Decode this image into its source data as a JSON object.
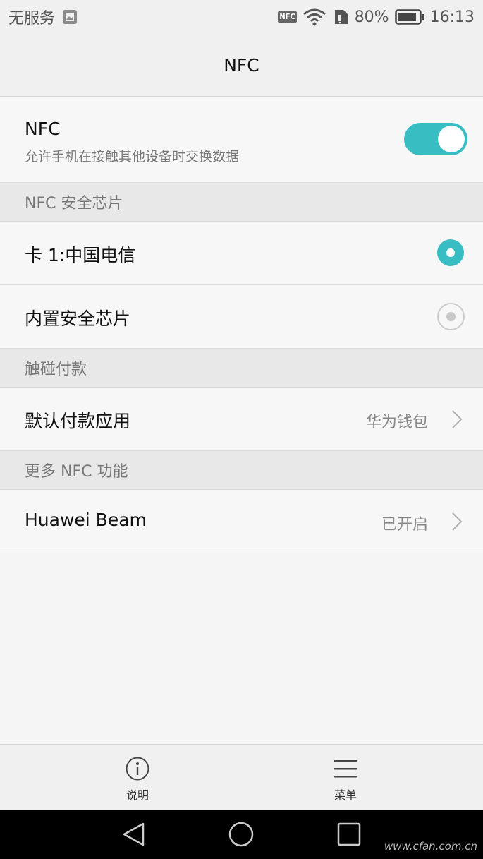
{
  "status_bar": {
    "carrier": "无服务",
    "nfc_badge": "NFC",
    "battery": "80%",
    "time": "16:13"
  },
  "title": "NFC",
  "nfc_row": {
    "title": "NFC",
    "subtitle": "允许手机在接触其他设备时交换数据",
    "toggle_state": "on"
  },
  "sections": {
    "secure_chip": "NFC 安全芯片",
    "tap_pay": "触碰付款",
    "more_nfc": "更多 NFC 功能"
  },
  "secure_chip_options": [
    {
      "label": "卡 1:中国电信",
      "selected": true
    },
    {
      "label": "内置安全芯片",
      "selected": false
    }
  ],
  "default_pay": {
    "label": "默认付款应用",
    "value": "华为钱包"
  },
  "huawei_beam": {
    "label": "Huawei Beam",
    "value": "已开启"
  },
  "bottom_bar": {
    "help_label": "说明",
    "menu_label": "菜单"
  },
  "watermark": "www.cfan.com.cn",
  "colors": {
    "accent": "#38bec2"
  }
}
